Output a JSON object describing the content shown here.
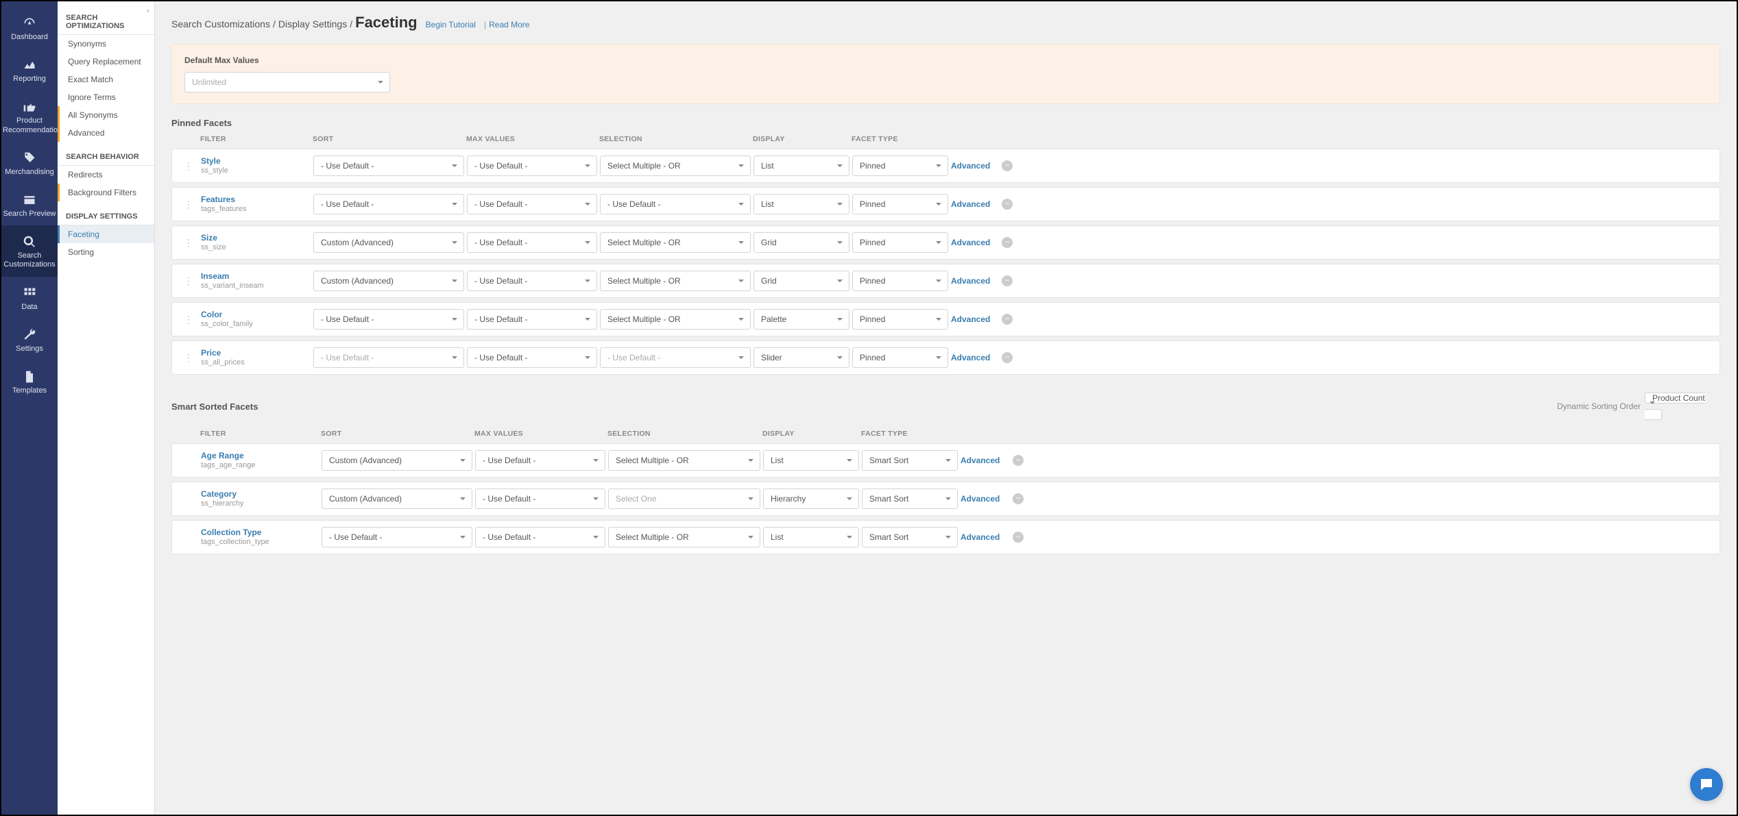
{
  "rail": [
    {
      "name": "dashboard",
      "label": "Dashboard",
      "active": false
    },
    {
      "name": "reporting",
      "label": "Reporting",
      "active": false
    },
    {
      "name": "recommendations",
      "label": "Product Recommendations",
      "active": false
    },
    {
      "name": "merchandising",
      "label": "Merchandising",
      "active": false
    },
    {
      "name": "search-preview",
      "label": "Search Preview",
      "active": false
    },
    {
      "name": "search-customizations",
      "label": "Search Customizations",
      "active": true
    },
    {
      "name": "data",
      "label": "Data",
      "active": false
    },
    {
      "name": "settings",
      "label": "Settings",
      "active": false
    },
    {
      "name": "templates",
      "label": "Templates",
      "active": false
    }
  ],
  "sidebar": {
    "groups": [
      {
        "title": "SEARCH OPTIMIZATIONS",
        "items": [
          {
            "label": "Synonyms"
          },
          {
            "label": "Query Replacement"
          },
          {
            "label": "Exact Match"
          },
          {
            "label": "Ignore Terms"
          },
          {
            "label": "All Synonyms",
            "hl": true
          },
          {
            "label": "Advanced",
            "hl": true
          }
        ]
      },
      {
        "title": "SEARCH BEHAVIOR",
        "items": [
          {
            "label": "Redirects"
          },
          {
            "label": "Background Filters",
            "hl": true
          }
        ]
      },
      {
        "title": "DISPLAY SETTINGS",
        "items": [
          {
            "label": "Faceting",
            "active": true
          },
          {
            "label": "Sorting"
          }
        ]
      }
    ]
  },
  "breadcrumb": {
    "a": "Search Customizations",
    "b": "Display Settings",
    "here": "Faceting",
    "tutorial": "Begin Tutorial",
    "more": "Read More",
    "sep": " / ",
    "pipe": " | "
  },
  "maxbox": {
    "label": "Default Max Values",
    "value": "Unlimited"
  },
  "columns": {
    "filter": "FILTER",
    "sort": "SORT",
    "max": "MAX VALUES",
    "sel": "SELECTION",
    "disp": "DISPLAY",
    "type": "FACET TYPE"
  },
  "pinned": {
    "title": "Pinned Facets",
    "rows": [
      {
        "name": "Style",
        "key": "ss_style",
        "sort": "- Use Default -",
        "max": "- Use Default -",
        "sel": "Select Multiple - OR",
        "disp": "List",
        "type": "Pinned"
      },
      {
        "name": "Features",
        "key": "tags_features",
        "sort": "- Use Default -",
        "max": "- Use Default -",
        "sel": "- Use Default -",
        "disp": "List",
        "type": "Pinned"
      },
      {
        "name": "Size",
        "key": "ss_size",
        "sort": "Custom (Advanced)",
        "max": "- Use Default -",
        "sel": "Select Multiple - OR",
        "disp": "Grid",
        "type": "Pinned"
      },
      {
        "name": "Inseam",
        "key": "ss_variant_inseam",
        "sort": "Custom (Advanced)",
        "max": "- Use Default -",
        "sel": "Select Multiple - OR",
        "disp": "Grid",
        "type": "Pinned"
      },
      {
        "name": "Color",
        "key": "ss_color_family",
        "sort": "- Use Default -",
        "max": "- Use Default -",
        "sel": "Select Multiple - OR",
        "disp": "Palette",
        "type": "Pinned"
      },
      {
        "name": "Price",
        "key": "ss_all_prices",
        "sort": "- Use Default -",
        "sortDim": true,
        "max": "- Use Default -",
        "sel": "- Use Default -",
        "selDim": true,
        "disp": "Slider",
        "type": "Pinned"
      }
    ]
  },
  "smart": {
    "title": "Smart Sorted Facets",
    "dynLabel": "Dynamic Sorting Order",
    "dynValue": "Product Count",
    "rows": [
      {
        "name": "Age Range",
        "key": "tags_age_range",
        "sort": "Custom (Advanced)",
        "max": "- Use Default -",
        "sel": "Select Multiple - OR",
        "disp": "List",
        "type": "Smart Sort"
      },
      {
        "name": "Category",
        "key": "ss_hierarchy",
        "sort": "Custom (Advanced)",
        "max": "- Use Default -",
        "sel": "Select One",
        "selDim": true,
        "disp": "Hierarchy",
        "type": "Smart Sort"
      },
      {
        "name": "Collection Type",
        "key": "tags_collection_type",
        "sort": "- Use Default -",
        "max": "- Use Default -",
        "sel": "Select Multiple - OR",
        "disp": "List",
        "type": "Smart Sort"
      }
    ]
  },
  "labels": {
    "advanced": "Advanced"
  }
}
